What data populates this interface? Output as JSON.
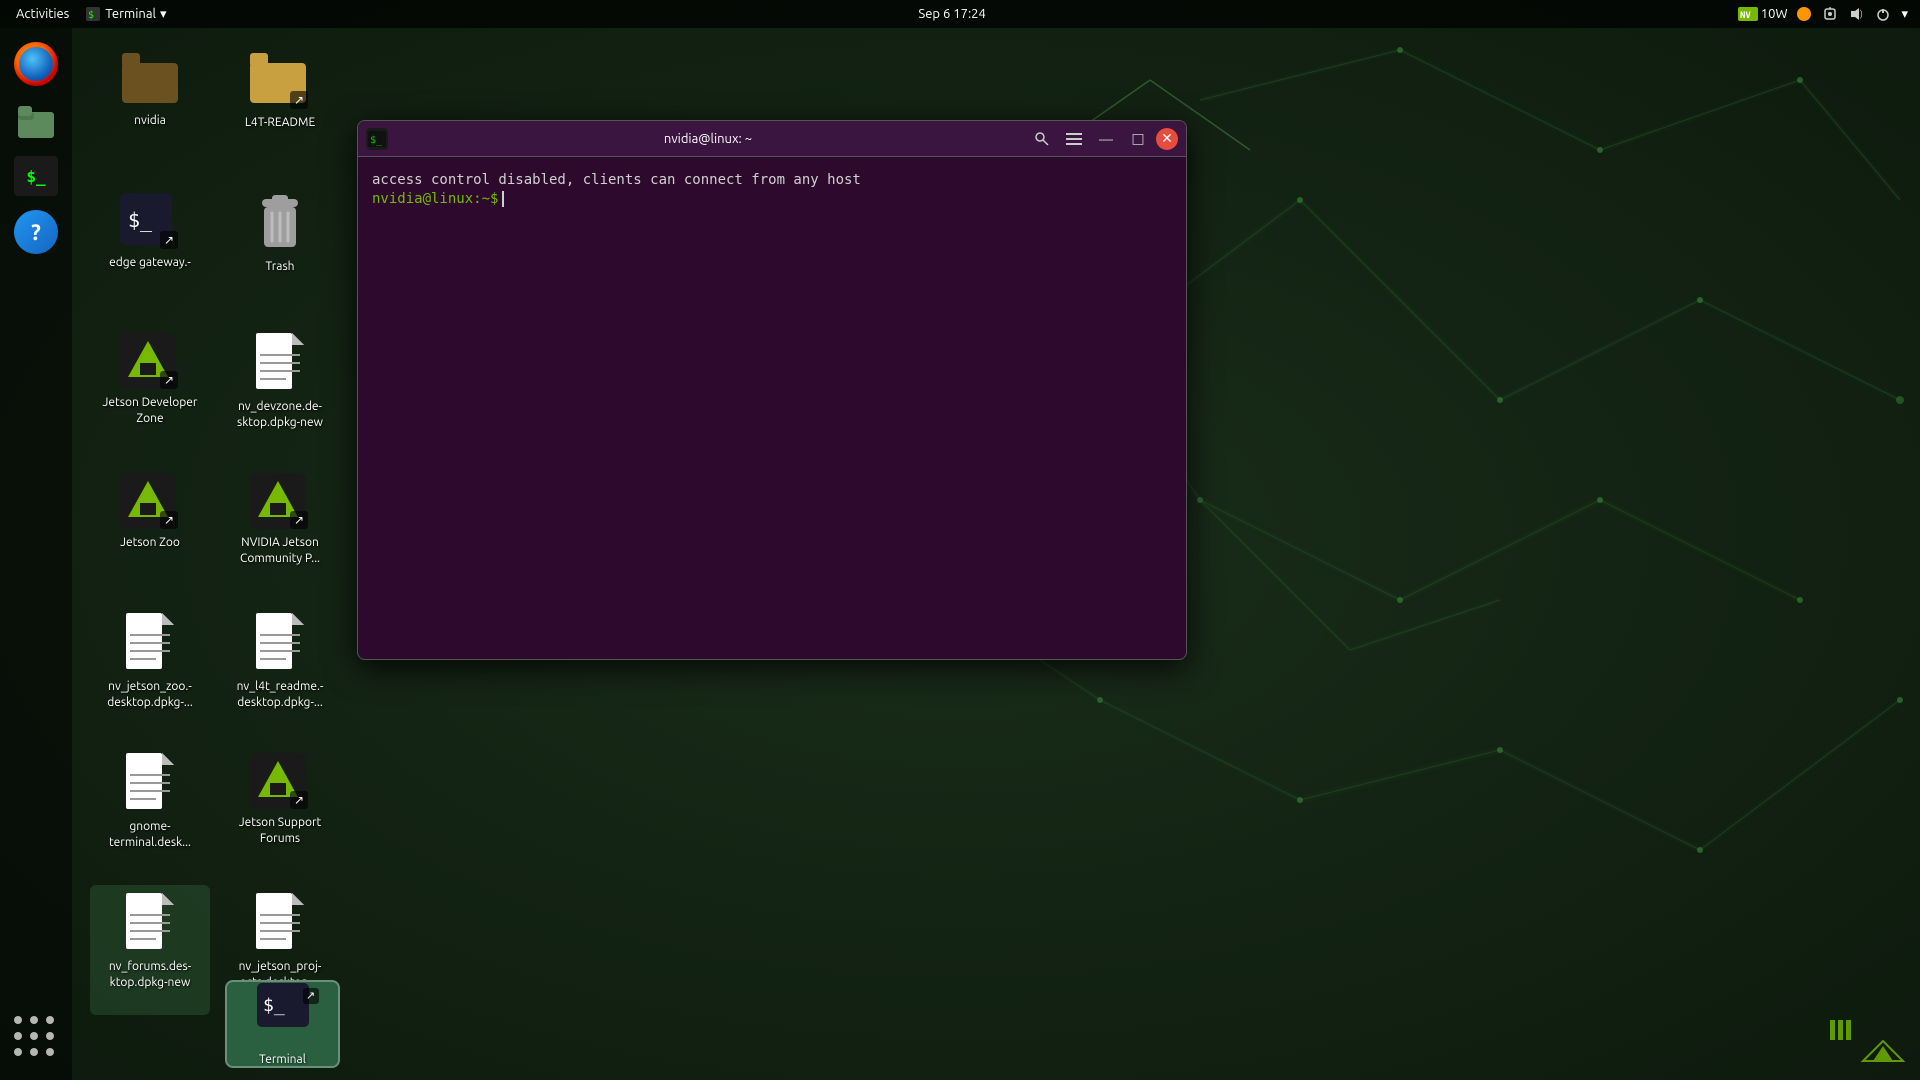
{
  "topbar": {
    "activities": "Activities",
    "terminal_menu": "Terminal",
    "datetime": "Sep 6  17:24",
    "power": "10W",
    "dropdown_arrow": "▾"
  },
  "dock": {
    "firefox_label": "Firefox",
    "files_label": "Files",
    "terminal_label": "Terminal",
    "help_label": "Help",
    "apps_label": "Apps"
  },
  "desktop_icons": [
    {
      "id": "nvidia-folder",
      "label": "nvidia",
      "type": "folder-dark"
    },
    {
      "id": "l4t-readme",
      "label": "L4T-README",
      "type": "folder-link"
    },
    {
      "id": "edge-gateway",
      "label": "edge gateway.-",
      "type": "terminal-link"
    },
    {
      "id": "trash",
      "label": "Trash",
      "type": "trash"
    },
    {
      "id": "jetson-dev",
      "label": "Jetson Developer Zone",
      "type": "nvidia-link"
    },
    {
      "id": "nv-devzone",
      "label": "nv_devzone.de-sktop.dpkg-new",
      "type": "document"
    },
    {
      "id": "jetson-zoo",
      "label": "Jetson Zoo",
      "type": "nvidia-link"
    },
    {
      "id": "nvidia-community",
      "label": "NVIDIA Jetson Community P...",
      "type": "nvidia-link"
    },
    {
      "id": "nv-jetson-zoo",
      "label": "nv_jetson_zoo.-desktop.dpkg-...",
      "type": "document"
    },
    {
      "id": "nv-l4t-readme",
      "label": "nv_l4t_readme.-desktop.dpkg-...",
      "type": "document"
    },
    {
      "id": "gnome-terminal",
      "label": "gnome-terminal.desk...",
      "type": "document"
    },
    {
      "id": "jetson-support",
      "label": "Jetson Support Forums",
      "type": "nvidia-link"
    },
    {
      "id": "nv-forums",
      "label": "nv_forums.des-ktop.dpkg-new",
      "type": "document-dark"
    },
    {
      "id": "nv-jetson-proj",
      "label": "nv_jetson_proj-ects.desktop....",
      "type": "document"
    },
    {
      "id": "terminal-taskbar",
      "label": "Terminal",
      "type": "terminal-taskbar"
    }
  ],
  "terminal": {
    "title": "nvidia@linux: ~",
    "output_line": "access control disabled, clients can connect from any host",
    "prompt": "nvidia@linux:~$",
    "prompt_color": "#76b900",
    "input": "",
    "search_icon": "🔍",
    "hamburger_icon": "☰",
    "minimize_icon": "—",
    "maximize_icon": "□",
    "close_icon": "✕"
  },
  "nvidia_icon": {
    "color": "#76b900",
    "text": "NVIDIA"
  },
  "bottom_dock": {
    "terminal_label": "Terminal"
  }
}
